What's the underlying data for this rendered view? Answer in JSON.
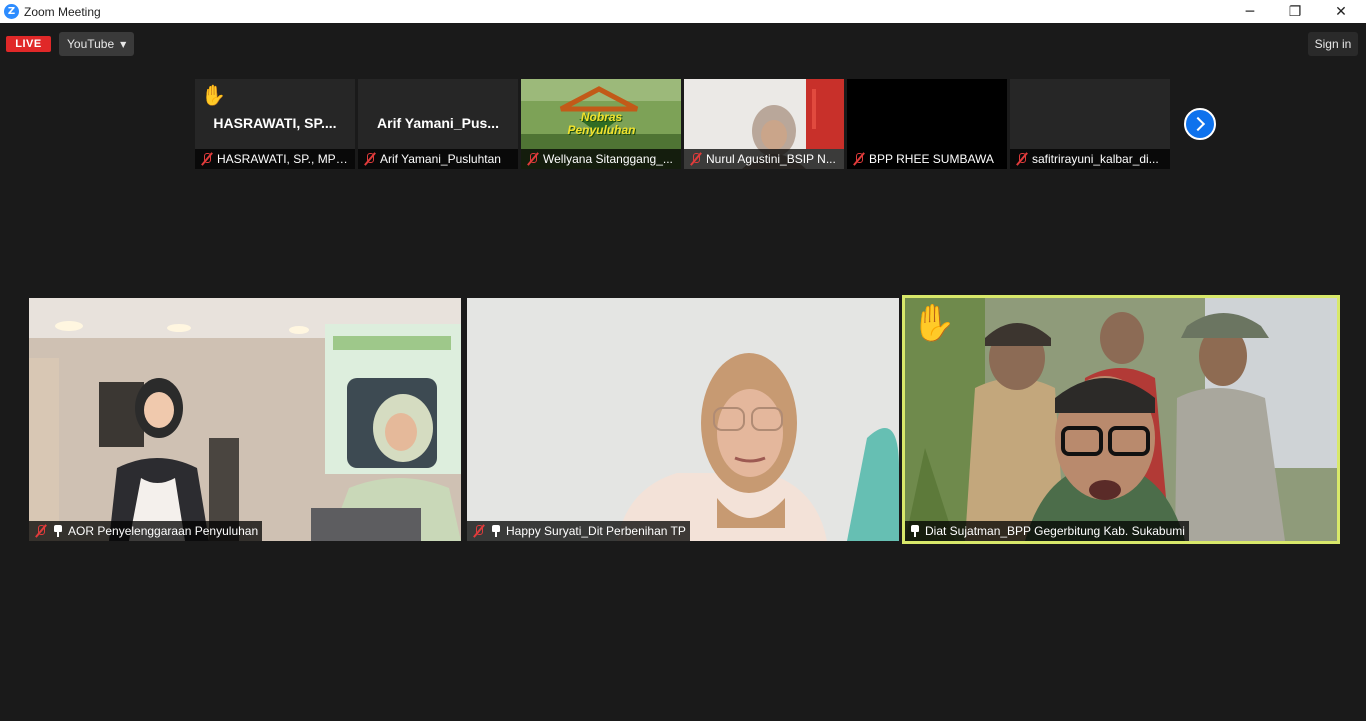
{
  "window": {
    "title": "Zoom Meeting",
    "logo": "Z"
  },
  "window_controls": {
    "minimize": "─",
    "restore": "❐",
    "close": "✕"
  },
  "topbar": {
    "live": "LIVE",
    "stream_target": "YouTube",
    "signin": "Sign in"
  },
  "strip": [
    {
      "display_name": "HASRAWATI, SP....",
      "label": "HASRAWATI, SP., MP_...",
      "hand_raised": true
    },
    {
      "display_name": "Arif Yamani_Pus...",
      "label": "Arif Yamani_Pusluhtan"
    },
    {
      "label": "Wellyana Sitanggang_...",
      "logo_text": "Nobras Penyuluhan"
    },
    {
      "label": "Nurul Agustini_BSIP N..."
    },
    {
      "label": "BPP RHEE SUMBAWA"
    },
    {
      "label": "safitrirayuni_kalbar_di..."
    }
  ],
  "gallery": [
    {
      "label": "AOR Penyelenggaraan Penyuluhan"
    },
    {
      "label": "Happy Suryati_Dit Perbenihan TP"
    },
    {
      "label": "Diat Sujatman_BPP Gegerbitung Kab. Sukabumi",
      "hand_raised": true
    }
  ],
  "colors": {
    "live": "#e02828",
    "accent": "#0e72ed",
    "active_speaker": "#d8e86a",
    "mic_off": "#e03b3b"
  }
}
